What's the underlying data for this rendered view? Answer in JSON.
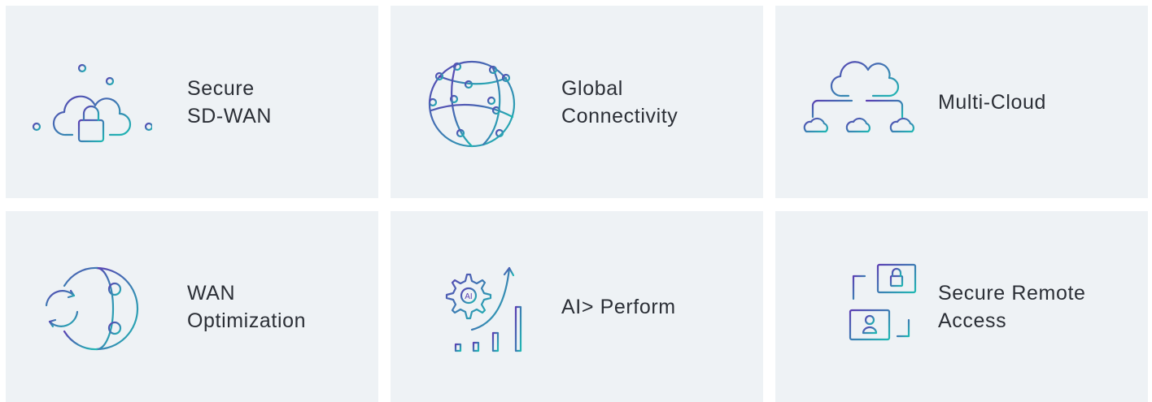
{
  "tiles": [
    {
      "label": "Secure\nSD-WAN",
      "icon": "cloud-lock-icon"
    },
    {
      "label": "Global\nConnectivity",
      "icon": "globe-network-icon"
    },
    {
      "label": "Multi-Cloud",
      "icon": "multi-cloud-icon"
    },
    {
      "label": "WAN\nOptimization",
      "icon": "globe-sync-icon"
    },
    {
      "label": "AI> Perform",
      "icon": "ai-gear-chart-icon"
    },
    {
      "label": "Secure Remote\nAccess",
      "icon": "remote-laptops-icon"
    }
  ],
  "colors": {
    "tile_bg": "#eef2f5",
    "text": "#2b2f36",
    "gradient_start": "#5b3fb3",
    "gradient_end": "#1fb8b3"
  }
}
